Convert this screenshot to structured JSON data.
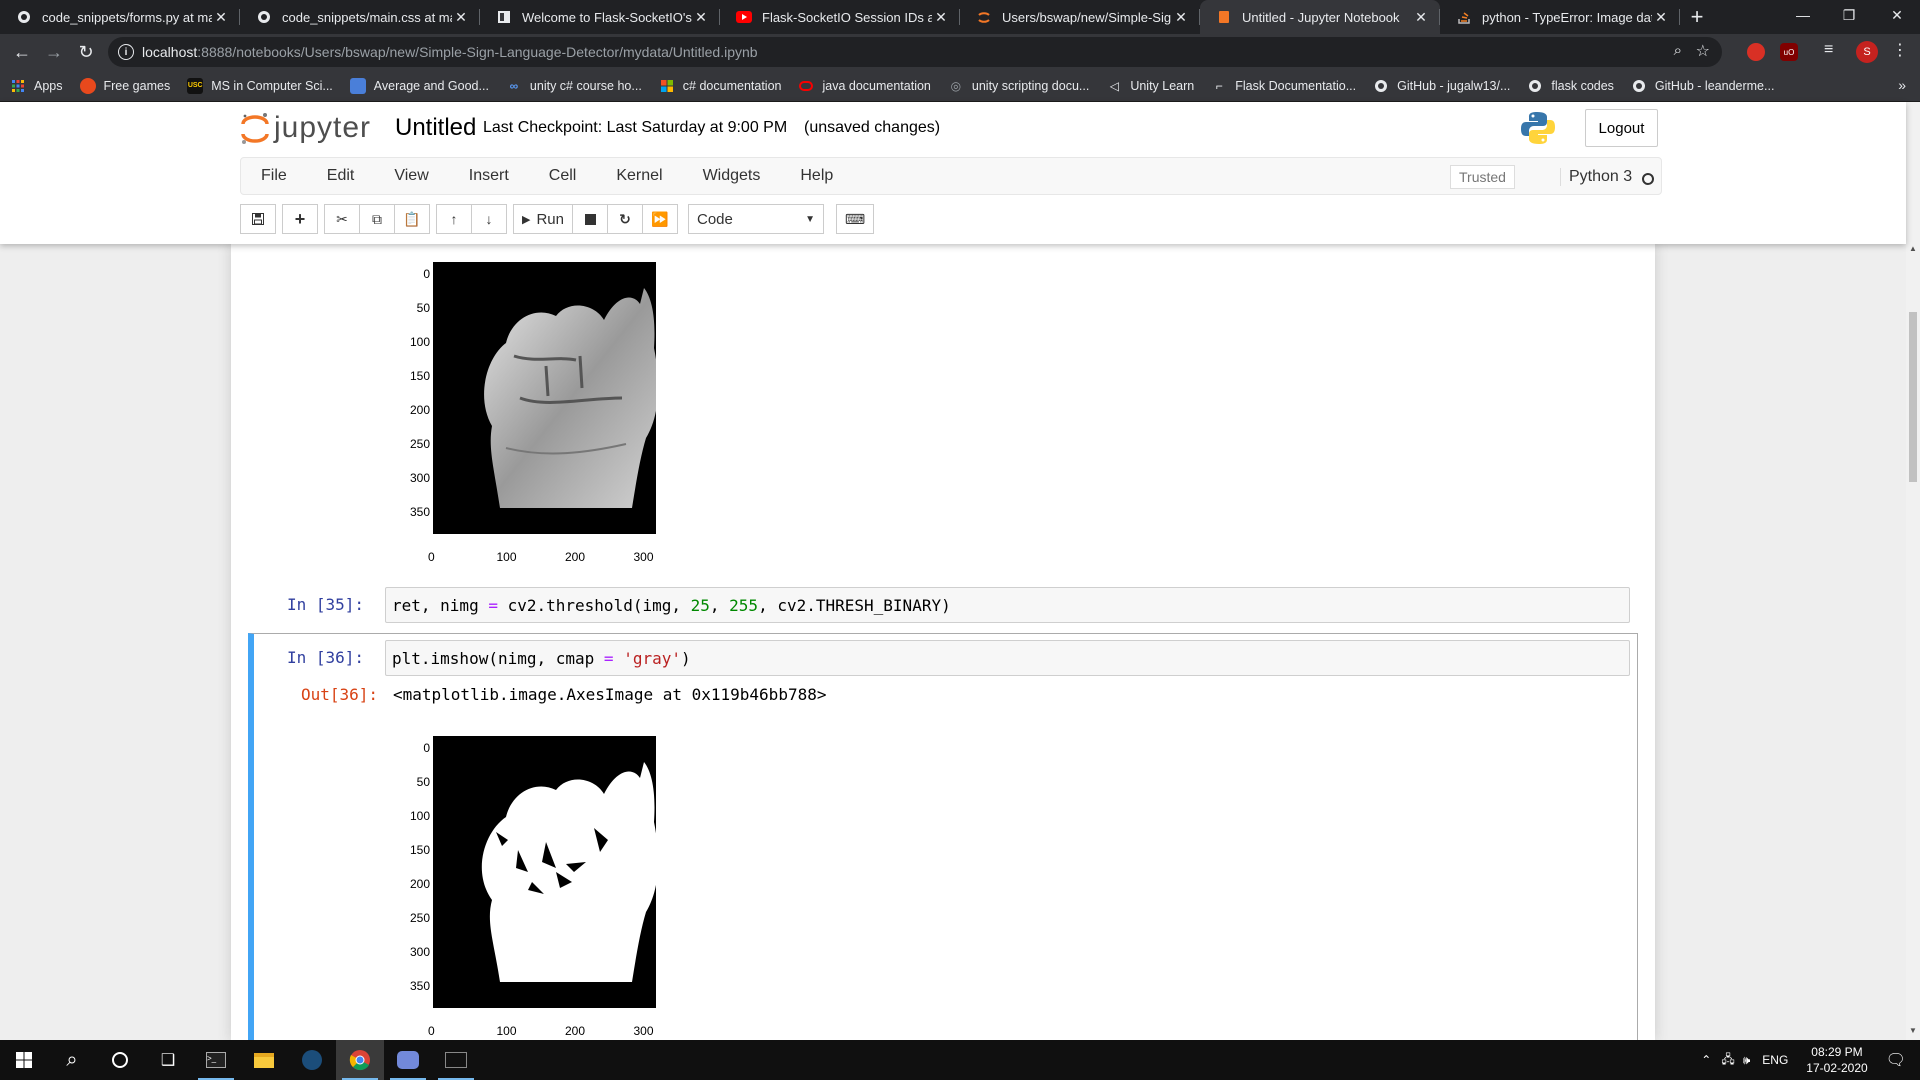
{
  "browser": {
    "tabs": [
      {
        "title": "code_snippets/forms.py at maste",
        "icon": "github-icon"
      },
      {
        "title": "code_snippets/main.css at maste",
        "icon": "github-icon"
      },
      {
        "title": "Welcome to Flask-SocketIO's doc",
        "icon": "docs-icon"
      },
      {
        "title": "Flask-SocketIO Session IDs and P",
        "icon": "youtube-icon"
      },
      {
        "title": "Users/bswap/new/Simple-Sign-L",
        "icon": "jupyter-icon"
      },
      {
        "title": "Untitled - Jupyter Notebook",
        "icon": "jupyter-notebook-icon",
        "active": true
      },
      {
        "title": "python - TypeError: Image data c",
        "icon": "stackoverflow-icon"
      }
    ],
    "url_host": "localhost",
    "url_path": ":8888/notebooks/Users/bswap/new/Simple-Sign-Language-Detector/mydata/Untitled.ipynb",
    "profile_initial": "S",
    "bookmarks": [
      {
        "label": "Apps",
        "icon": "apps-icon"
      },
      {
        "label": "Free games",
        "icon": "free-games-icon"
      },
      {
        "label": "MS in Computer Sci...",
        "icon": "usc-icon"
      },
      {
        "label": "Average and Good...",
        "icon": "average-icon"
      },
      {
        "label": "unity c# course ho...",
        "icon": "udemy-icon"
      },
      {
        "label": "c# documentation",
        "icon": "microsoft-icon"
      },
      {
        "label": "java documentation",
        "icon": "oracle-icon"
      },
      {
        "label": "unity scripting docu...",
        "icon": "unity-icon"
      },
      {
        "label": "Unity Learn",
        "icon": "unity-learn-icon"
      },
      {
        "label": "Flask Documentatio...",
        "icon": "flask-icon"
      },
      {
        "label": "GitHub - jugalw13/...",
        "icon": "github-icon"
      },
      {
        "label": "flask codes",
        "icon": "github-icon"
      },
      {
        "label": "GitHub - leanderme...",
        "icon": "github-icon"
      }
    ]
  },
  "jupyter": {
    "logo_text": "jupyter",
    "notebook_name": "Untitled",
    "checkpoint": "Last Checkpoint: Last Saturday at 9:00 PM",
    "unsaved": "(unsaved changes)",
    "logout": "Logout",
    "menu": [
      "File",
      "Edit",
      "View",
      "Insert",
      "Cell",
      "Kernel",
      "Widgets",
      "Help"
    ],
    "trusted": "Trusted",
    "kernel": "Python 3",
    "toolbar": {
      "run": "Run",
      "cell_type": "Code"
    }
  },
  "cells": {
    "cell35": {
      "prompt": "In [35]:"
    },
    "cell36": {
      "prompt_in": "In [36]:",
      "prompt_out": "Out[36]:",
      "output": "<matplotlib.image.AxesImage at 0x119b46bb788>"
    }
  },
  "plots": {
    "y_ticks": [
      "0",
      "50",
      "100",
      "150",
      "200",
      "250",
      "300",
      "350"
    ],
    "x_ticks": [
      "0",
      "100",
      "200",
      "300"
    ]
  },
  "taskbar": {
    "lang": "ENG",
    "time": "08:29 PM",
    "date": "17-02-2020"
  }
}
